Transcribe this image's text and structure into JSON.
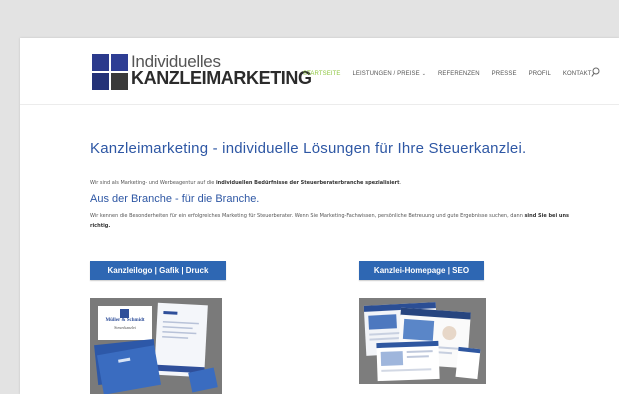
{
  "logo": {
    "line1": "Individuelles",
    "line2": "KANZLEIMARKETING"
  },
  "nav": {
    "items": [
      {
        "label": "STARTSEITE",
        "active": true
      },
      {
        "label": "LEISTUNGEN / PREISE",
        "has_dropdown": true
      },
      {
        "label": "REFERENZEN"
      },
      {
        "label": "PRESSE"
      },
      {
        "label": "PROFIL"
      },
      {
        "label": "KONTAKT"
      }
    ],
    "active_color": "#8dc63f",
    "search_icon": "search-icon"
  },
  "content": {
    "heading": "Kanzleimarketing - individuelle Lösungen für Ihre Steuerkanzlei.",
    "intro_prefix": "Wir sind als Marketing- und Werbeagentur auf die",
    "intro_bold": "individuellen Bedürfnisse der Steuerberaterbranche spezialisiert",
    "intro_suffix": ".",
    "subheading": "Aus der Branche - für die Branche.",
    "para_text": "Wir kennen die Besonderheiten für ein erfolgreiches Marketing für Steuerberater. Wenn Sie Marketing-Fachwissen, persönliche Betreuung und gute Ergebnisse suchen, dann",
    "para_bold": "sind Sie bei uns richtig."
  },
  "buttons": {
    "logo_button": "Kanzleilogo | Gafik | Druck",
    "homepage_button": "Kanzlei-Homepage | SEO"
  },
  "thumb1": {
    "brand_line1": "Müller & Schmidt",
    "brand_line2": "Steuerkanzlei"
  },
  "colors": {
    "heading": "#2e57a4",
    "button": "#2e67b3",
    "logo_blue": "#2b3a8c"
  }
}
